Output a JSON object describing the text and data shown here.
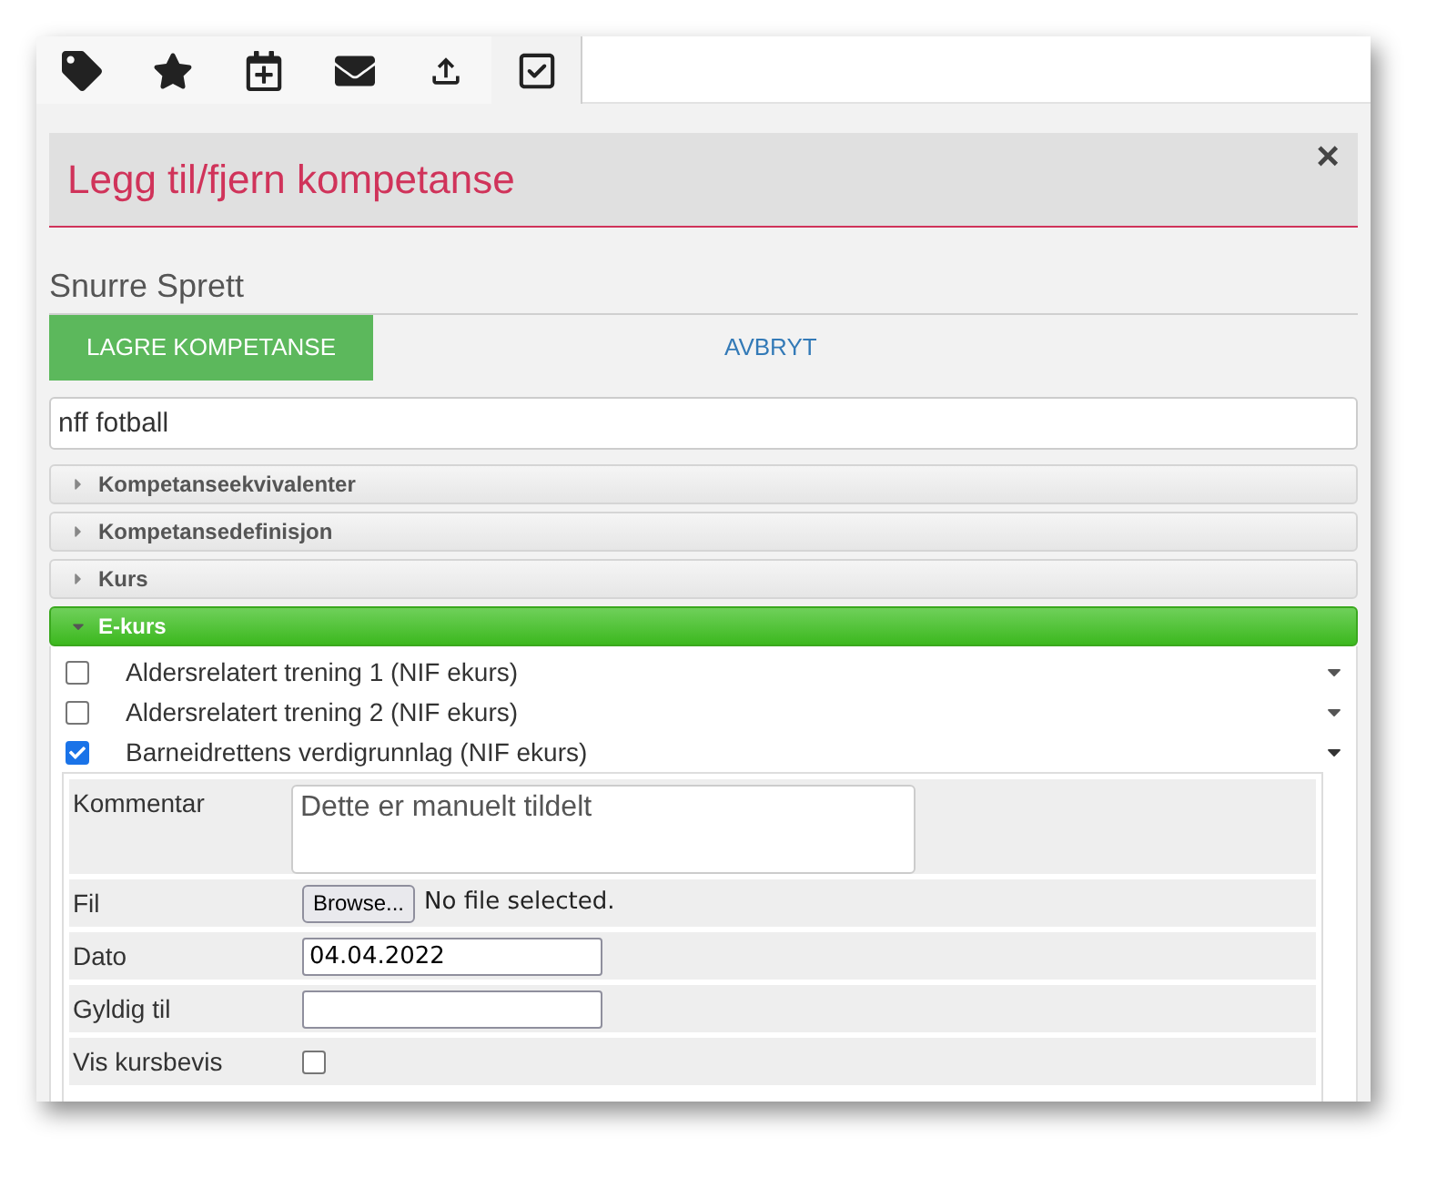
{
  "tabs": [
    {
      "kind": "tag",
      "selected": false
    },
    {
      "kind": "star",
      "selected": false
    },
    {
      "kind": "calendar",
      "selected": false
    },
    {
      "kind": "mail",
      "selected": false
    },
    {
      "kind": "upload",
      "selected": false
    },
    {
      "kind": "check",
      "selected": true
    }
  ],
  "dialog": {
    "title": "Legg til/fjern kompetanse",
    "close": "×",
    "person": "Snurre Sprett",
    "save_button": "LAGRE KOMPETANSE",
    "cancel_button": "AVBRYT",
    "search": {
      "value": "nff fotball"
    }
  },
  "sections": [
    {
      "label": "Kompetanseekvivalenter",
      "expanded": false
    },
    {
      "label": "Kompetansedefinisjon",
      "expanded": false
    },
    {
      "label": "Kurs",
      "expanded": false
    },
    {
      "label": "E-kurs",
      "expanded": true
    }
  ],
  "courses": [
    {
      "label": "Aldersrelatert trening 1 (NIF ekurs)",
      "checked": false,
      "expanded": false
    },
    {
      "label": "Aldersrelatert trening 2 (NIF ekurs)",
      "checked": false,
      "expanded": false
    },
    {
      "label": "Barneidrettens verdigrunnlag (NIF ekurs)",
      "checked": true,
      "expanded": true
    }
  ],
  "details": {
    "comment_label": "Kommentar",
    "comment_value": "Dette er manuelt tildelt",
    "file_label": "Fil",
    "browse_button": "Browse...",
    "file_status": "No file selected.",
    "date_label": "Dato",
    "date_value": "04.04.2022",
    "valid_label": "Gyldig til",
    "certificate_label": "Vis kursbevis",
    "certificate_checked": false
  }
}
